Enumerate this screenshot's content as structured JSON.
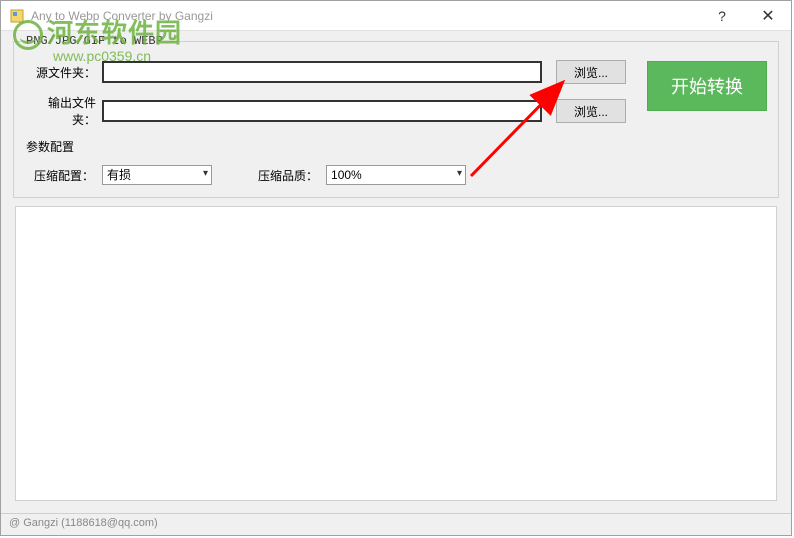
{
  "window": {
    "title": "Any to Webp Converter by Gangzi"
  },
  "watermark": {
    "main": "河东软件园",
    "sub": "www.pc0359.cn"
  },
  "groupbox": {
    "title": "PNG/JPG/GIF to WEBP"
  },
  "form": {
    "source_label": "源文件夹：",
    "source_value": "",
    "output_label": "输出文件夹：",
    "output_value": "",
    "browse_label": "浏览...",
    "start_label": "开始转换"
  },
  "params": {
    "section_label": "参数配置",
    "mode_label": "压缩配置：",
    "mode_value": "有损",
    "quality_label": "压缩品质：",
    "quality_value": "100%"
  },
  "statusbar": {
    "text": "@ Gangzi (1188618@qq.com)"
  }
}
